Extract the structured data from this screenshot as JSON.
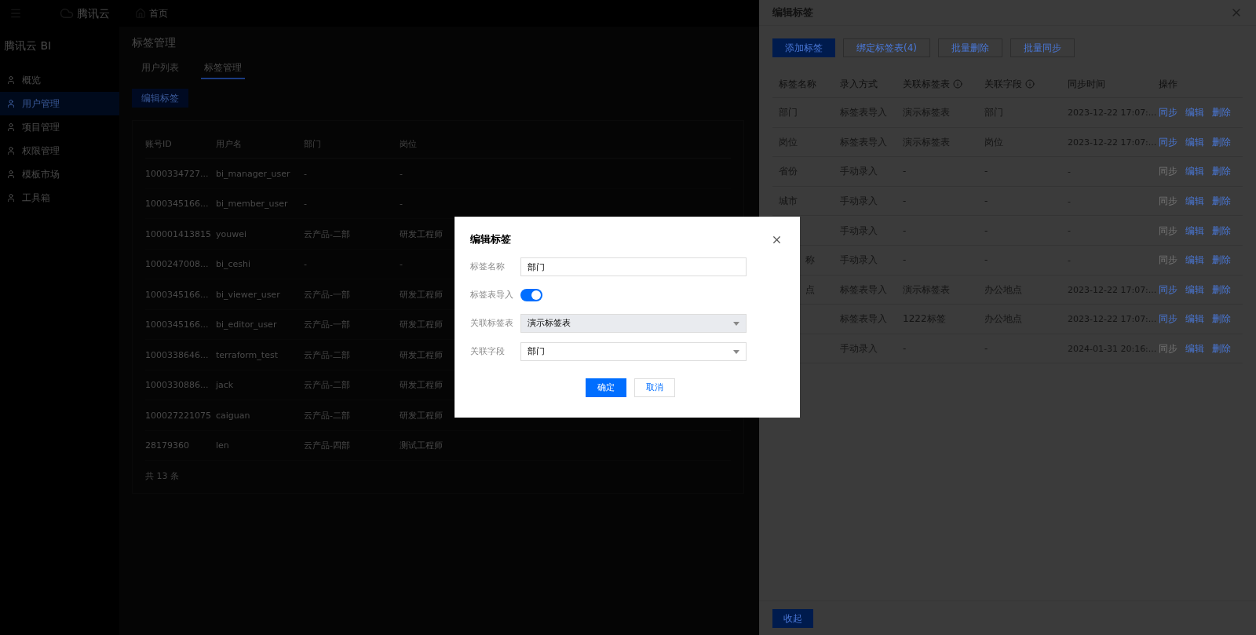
{
  "topbar": {
    "brand": "腾讯云",
    "nav": "首页"
  },
  "sidebar": {
    "title": "腾讯云 BI",
    "items": [
      {
        "label": "概览",
        "selected": false
      },
      {
        "label": "用户管理",
        "selected": true
      },
      {
        "label": "项目管理",
        "selected": false
      },
      {
        "label": "权限管理",
        "selected": false
      },
      {
        "label": "模板市场",
        "selected": false
      },
      {
        "label": "工具箱",
        "selected": false
      }
    ]
  },
  "page": {
    "title": "标签管理",
    "tabs": [
      {
        "label": "用户列表",
        "selected": false
      },
      {
        "label": "标签管理",
        "selected": true
      }
    ],
    "button": "编辑标签",
    "table": {
      "columns": [
        "账号ID",
        "用户名",
        "部门",
        "岗位"
      ],
      "rows": [
        [
          "1000334727...",
          "bi_manager_user",
          "-",
          "-"
        ],
        [
          "1000345166...",
          "bi_member_user",
          "-",
          "-"
        ],
        [
          "100001413815",
          "youwei",
          "云产品-二部",
          "研发工程师"
        ],
        [
          "1000247008...",
          "bi_ceshi",
          "-",
          "-"
        ],
        [
          "1000345166...",
          "bi_viewer_user",
          "云产品-一部",
          "研发工程师"
        ],
        [
          "1000345166...",
          "bi_editor_user",
          "云产品-一部",
          "研发工程师"
        ],
        [
          "1000338646...",
          "terraform_test",
          "云产品-二部",
          "研发工程师"
        ],
        [
          "1000330886...",
          "jack",
          "云产品-二部",
          "研发工程师"
        ],
        [
          "100027221075",
          "caiguan",
          "云产品-二部",
          "研发工程师"
        ],
        [
          "28179360",
          "len",
          "云产品-四部",
          "测试工程师"
        ]
      ],
      "total": "共 13 条"
    }
  },
  "drawer": {
    "title": "编辑标签",
    "buttons": [
      {
        "label": "添加标签",
        "kind": "primary"
      },
      {
        "label": "绑定标签表(4)",
        "kind": "default"
      },
      {
        "label": "批量删除",
        "kind": "default"
      },
      {
        "label": "批量同步",
        "kind": "default"
      }
    ],
    "columns": [
      {
        "label": "标签名称",
        "kind": "plain"
      },
      {
        "label": "录入方式",
        "kind": "plain"
      },
      {
        "label": "关联标签表",
        "kind": "info"
      },
      {
        "label": "关联字段",
        "kind": "info"
      },
      {
        "label": "同步时间",
        "kind": "plain"
      },
      {
        "label": "操作",
        "kind": "plain"
      }
    ],
    "rows": [
      {
        "name": "部门",
        "name_clipped": false,
        "method": "标签表导入",
        "table": "演示标签表",
        "field": "部门",
        "time": "2023-12-22 17:07:...",
        "actions": [
          {
            "label": "同步",
            "enabled": true
          },
          {
            "label": "编辑",
            "enabled": true
          },
          {
            "label": "删除",
            "enabled": true
          }
        ]
      },
      {
        "name": "岗位",
        "name_clipped": false,
        "method": "标签表导入",
        "table": "演示标签表",
        "field": "岗位",
        "time": "2023-12-22 17:07:...",
        "actions": [
          {
            "label": "同步",
            "enabled": true
          },
          {
            "label": "编辑",
            "enabled": true
          },
          {
            "label": "删除",
            "enabled": true
          }
        ]
      },
      {
        "name": "省份",
        "name_clipped": false,
        "method": "手动录入",
        "table": "-",
        "field": "-",
        "time": "-",
        "actions": [
          {
            "label": "同步",
            "enabled": false
          },
          {
            "label": "编辑",
            "enabled": true
          },
          {
            "label": "删除",
            "enabled": true
          }
        ]
      },
      {
        "name": "城市",
        "name_clipped": false,
        "method": "手动录入",
        "table": "-",
        "field": "-",
        "time": "-",
        "actions": [
          {
            "label": "同步",
            "enabled": false
          },
          {
            "label": "编辑",
            "enabled": true
          },
          {
            "label": "删除",
            "enabled": true
          }
        ]
      },
      {
        "method": "手动录入",
        "table": "-",
        "field": "-",
        "time": "-",
        "actions": [
          {
            "label": "同步",
            "enabled": false
          },
          {
            "label": "编辑",
            "enabled": true
          },
          {
            "label": "删除",
            "enabled": true
          }
        ]
      },
      {
        "name": "称",
        "name_clipped": true,
        "method": "手动录入",
        "table": "-",
        "field": "-",
        "time": "-",
        "actions": [
          {
            "label": "同步",
            "enabled": false
          },
          {
            "label": "编辑",
            "enabled": true
          },
          {
            "label": "删除",
            "enabled": true
          }
        ]
      },
      {
        "name": "点",
        "name_clipped": true,
        "method": "标签表导入",
        "table": "演示标签表",
        "field": "办公地点",
        "time": "2023-12-22 17:07:...",
        "actions": [
          {
            "label": "同步",
            "enabled": true
          },
          {
            "label": "编辑",
            "enabled": true
          },
          {
            "label": "删除",
            "enabled": true
          }
        ]
      },
      {
        "method": "标签表导入",
        "table": "1222标签",
        "field": "办公地点",
        "time": "2023-12-22 17:07:...",
        "actions": [
          {
            "label": "同步",
            "enabled": true
          },
          {
            "label": "编辑",
            "enabled": true
          },
          {
            "label": "删除",
            "enabled": true
          }
        ]
      },
      {
        "method": "手动录入",
        "table": "-",
        "field": "-",
        "time": "2024-01-31 20:16:...",
        "actions": [
          {
            "label": "同步",
            "enabled": false
          },
          {
            "label": "编辑",
            "enabled": true
          },
          {
            "label": "删除",
            "enabled": true
          }
        ]
      }
    ],
    "footer_button": "收起"
  },
  "modal": {
    "title": "编辑标签",
    "fields": [
      {
        "kind": "input",
        "label": "标签名称",
        "value": "部门"
      },
      {
        "kind": "switch",
        "label": "标签表导入",
        "on": true
      },
      {
        "kind": "select",
        "label": "关联标签表",
        "value": "演示标签表",
        "disabled": true
      },
      {
        "kind": "select",
        "label": "关联字段",
        "value": "部门",
        "disabled": false
      }
    ],
    "buttons": [
      {
        "label": "确定",
        "kind": "primary"
      },
      {
        "label": "取消",
        "kind": "default"
      }
    ]
  }
}
